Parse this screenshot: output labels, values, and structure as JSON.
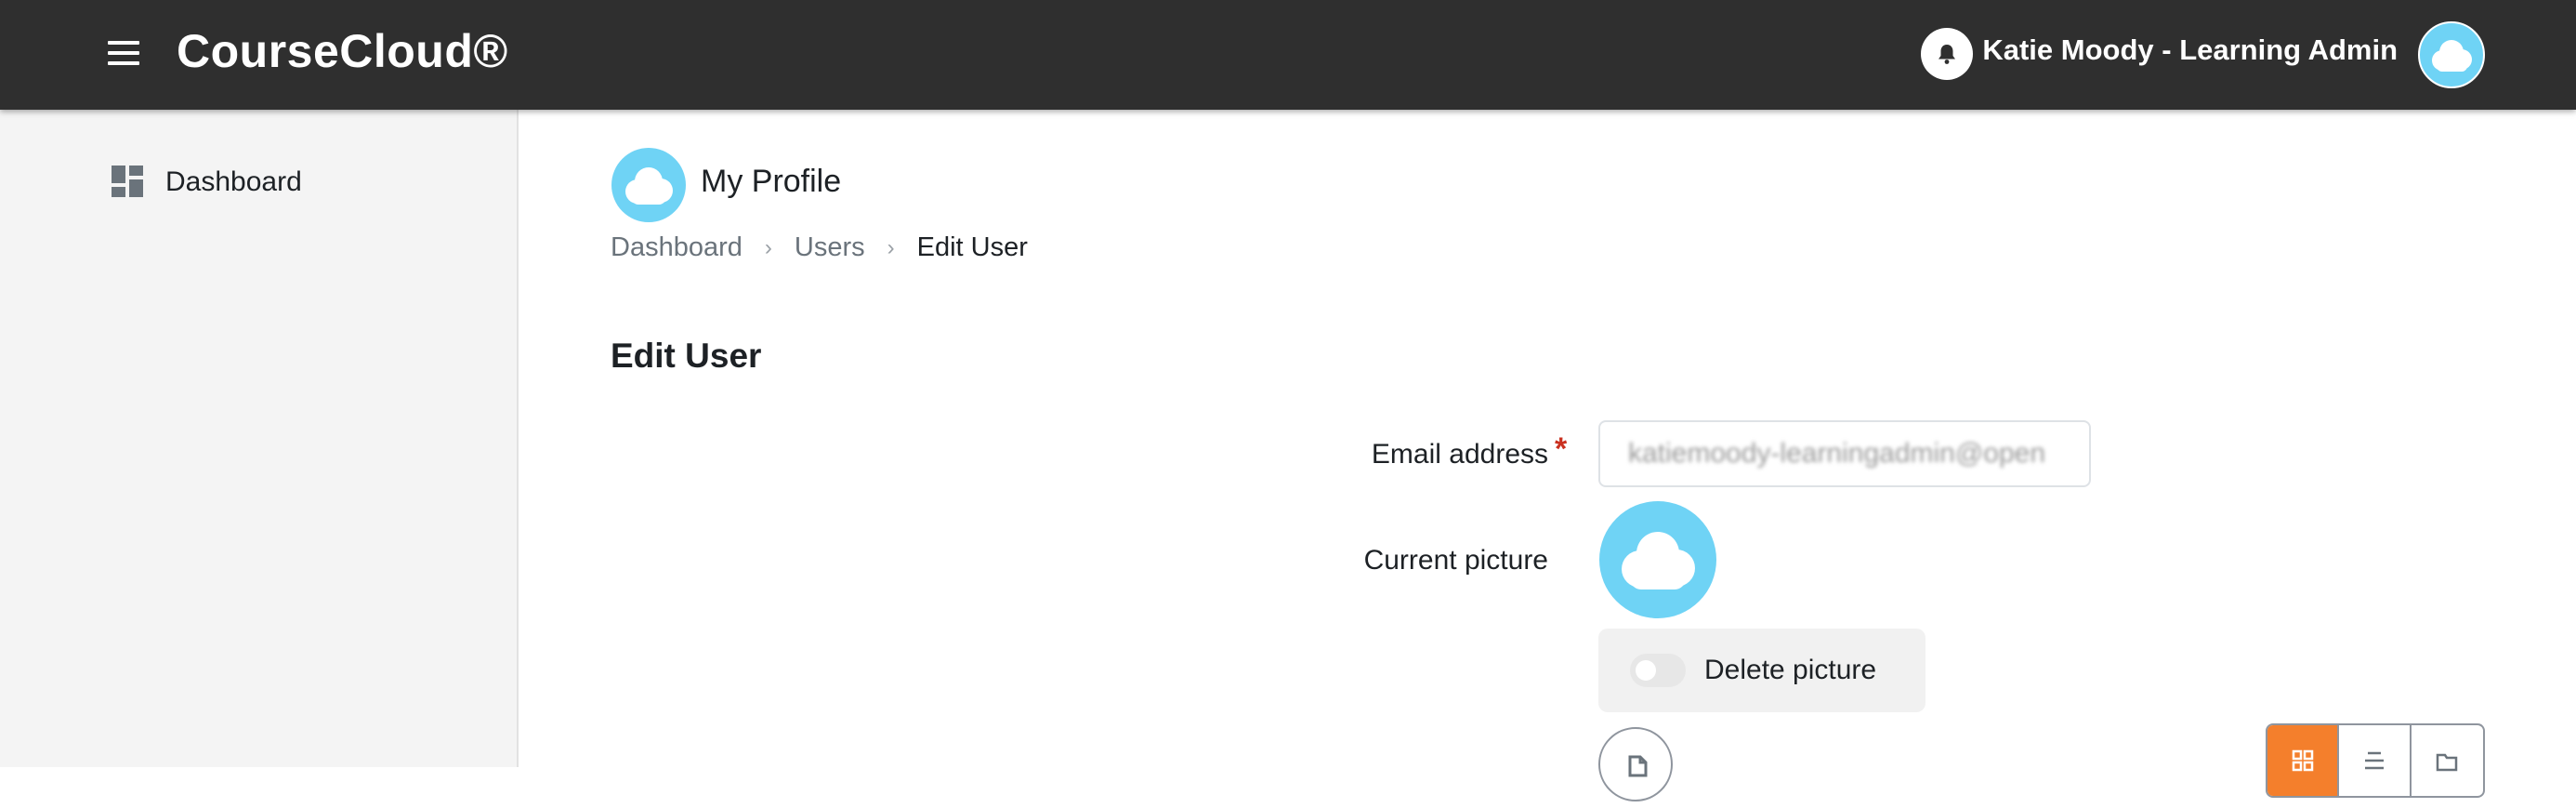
{
  "header": {
    "brand": "CourseCloud®",
    "user_name": "Katie Moody - Learning Admin"
  },
  "sidebar": {
    "items": [
      {
        "label": "Dashboard",
        "icon": "dashboard-icon"
      }
    ]
  },
  "profile": {
    "title": "My Profile"
  },
  "breadcrumb": {
    "items": [
      "Dashboard",
      "Users"
    ],
    "current": "Edit User"
  },
  "page": {
    "heading": "Edit User"
  },
  "form": {
    "email_label": "Email address",
    "email_value": "katiemoody-learningadmin@open",
    "required_mark": "*",
    "picture_label": "Current picture",
    "delete_picture_label": "Delete picture"
  },
  "colors": {
    "topbar": "#2f2f2f",
    "accent": "#f47f2c",
    "avatar": "#6fd3f5",
    "required": "#ca3120"
  }
}
